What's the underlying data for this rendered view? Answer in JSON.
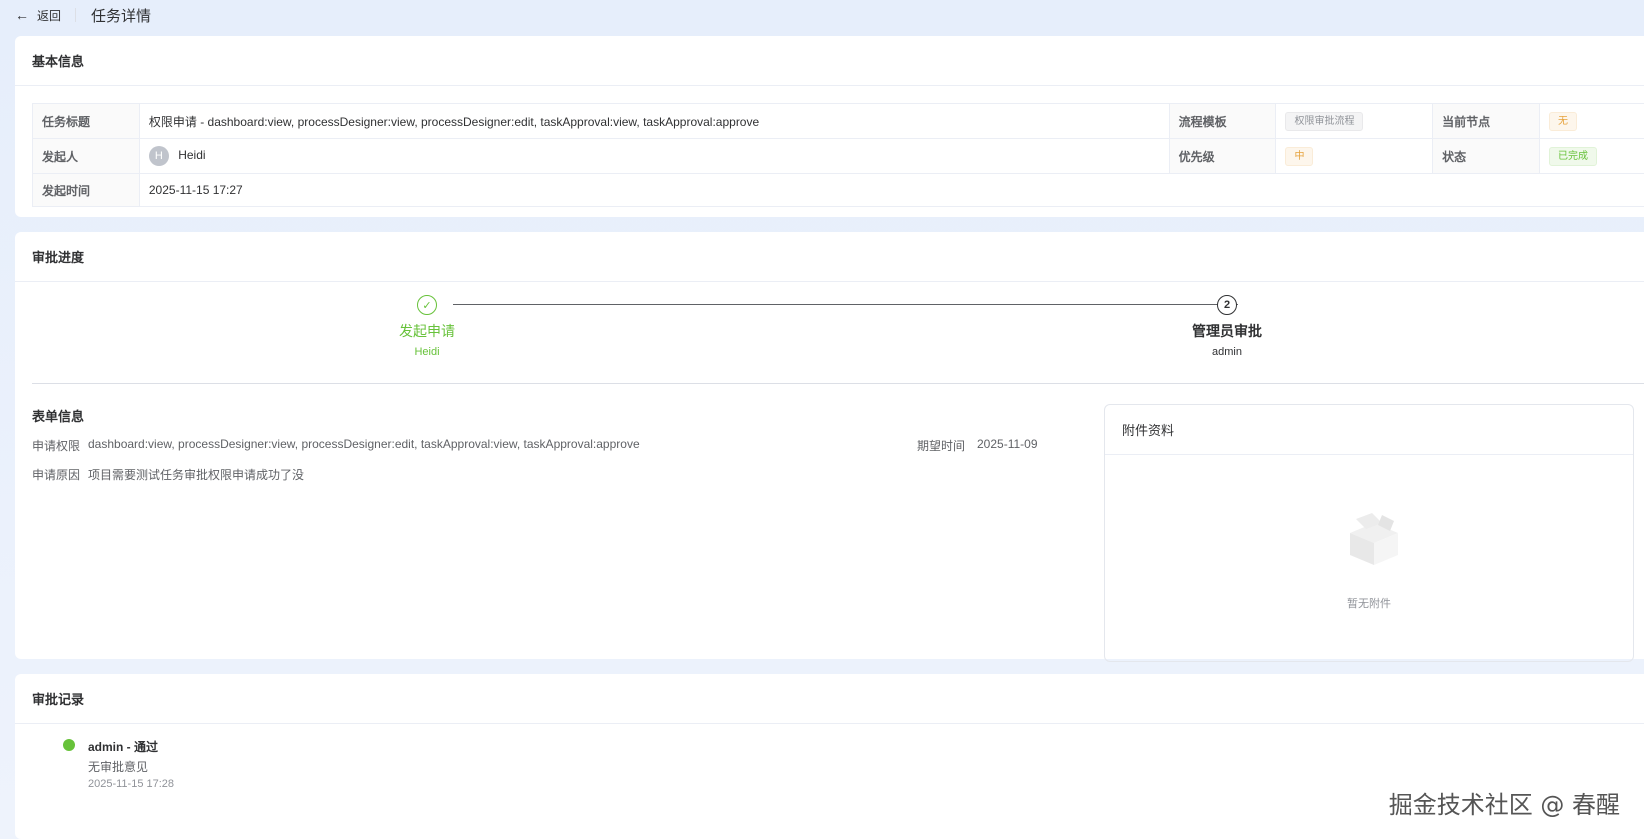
{
  "topbar": {
    "back_label": "返回",
    "title": "任务详情"
  },
  "basic": {
    "header": "基本信息",
    "rows": {
      "task_title_label": "任务标题",
      "task_title_value": "权限申请 - dashboard:view, processDesigner:view, processDesigner:edit, taskApproval:view, taskApproval:approve",
      "template_label": "流程模板",
      "template_value": "权限审批流程",
      "node_label": "当前节点",
      "node_value": "无",
      "initiator_label": "发起人",
      "initiator_avatar": "H",
      "initiator_value": "Heidi",
      "priority_label": "优先级",
      "priority_value": "中",
      "status_label": "状态",
      "status_value": "已完成",
      "time_label": "发起时间",
      "time_value": "2025-11-15 17:27"
    }
  },
  "progress": {
    "header": "审批进度",
    "steps": [
      {
        "icon": "check-icon",
        "name": "发起申请",
        "who": "Heidi",
        "state": "done"
      },
      {
        "number": "2",
        "name": "管理员审批",
        "who": "admin",
        "state": "current"
      }
    ],
    "form": {
      "title": "表单信息",
      "perm_label": "申请权限",
      "perm_value": "dashboard:view, processDesigner:view, processDesigner:edit, taskApproval:view, taskApproval:approve",
      "expect_label": "期望时间",
      "expect_value": "2025-11-09",
      "reason_label": "申请原因",
      "reason_value": "项目需要测试任务审批权限申请成功了没"
    },
    "attachments": {
      "header": "附件资料",
      "empty_text": "暂无附件",
      "empty_icon": "empty-box-icon"
    }
  },
  "records": {
    "header": "审批记录",
    "items": [
      {
        "title": "admin - 通过",
        "comment": "无审批意见",
        "time": "2025-11-15 17:28",
        "color": "#67c23a"
      }
    ]
  },
  "watermark": "掘金技术社区 @ 春醒",
  "colors": {
    "success": "#67c23a",
    "warning": "#e6a23c",
    "info": "#909399"
  }
}
